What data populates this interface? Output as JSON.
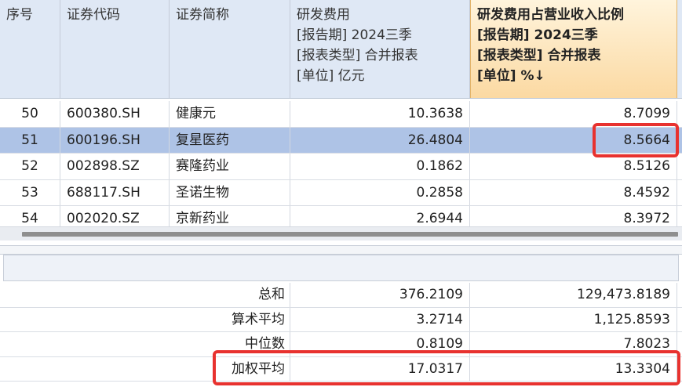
{
  "header": {
    "seq": "序号",
    "code": "证券代码",
    "name": "证券简称",
    "rd": {
      "line1": "研发费用",
      "line2": "[报告期] 2024三季",
      "line3": "[报表类型] 合并报表",
      "line4": "[单位] 亿元"
    },
    "ratio": {
      "line1": "研发费用占营业收入比例",
      "line2": "[报告期] 2024三季",
      "line3": "[报表类型] 合并报表",
      "line4": "[单位] %↓"
    }
  },
  "rows": [
    {
      "seq": "50",
      "code": "600380.SH",
      "name": "健康元",
      "rd": "10.3638",
      "ratio": "8.7099"
    },
    {
      "seq": "51",
      "code": "600196.SH",
      "name": "复星医药",
      "rd": "26.4804",
      "ratio": "8.5664"
    },
    {
      "seq": "52",
      "code": "002898.SZ",
      "name": "赛隆药业",
      "rd": "0.1862",
      "ratio": "8.5126"
    },
    {
      "seq": "53",
      "code": "688117.SH",
      "name": "圣诺生物",
      "rd": "0.2858",
      "ratio": "8.4592"
    },
    {
      "seq": "54",
      "code": "002020.SZ",
      "name": "京新药业",
      "rd": "2.6944",
      "ratio": "8.3972"
    }
  ],
  "stats": [
    {
      "label": "总和",
      "rd": "376.2109",
      "ratio": "129,473.8189"
    },
    {
      "label": "算术平均",
      "rd": "3.2714",
      "ratio": "1,125.8593"
    },
    {
      "label": "中位数",
      "rd": "0.8109",
      "ratio": "7.8023"
    },
    {
      "label": "加权平均",
      "rd": "17.0317",
      "ratio": "13.3304"
    }
  ],
  "colors": {
    "header_bg": "#dfe8f5",
    "sorted_header": "#fbd9a2",
    "selected_row": "#aec3e6",
    "highlight": "#e8322f"
  }
}
